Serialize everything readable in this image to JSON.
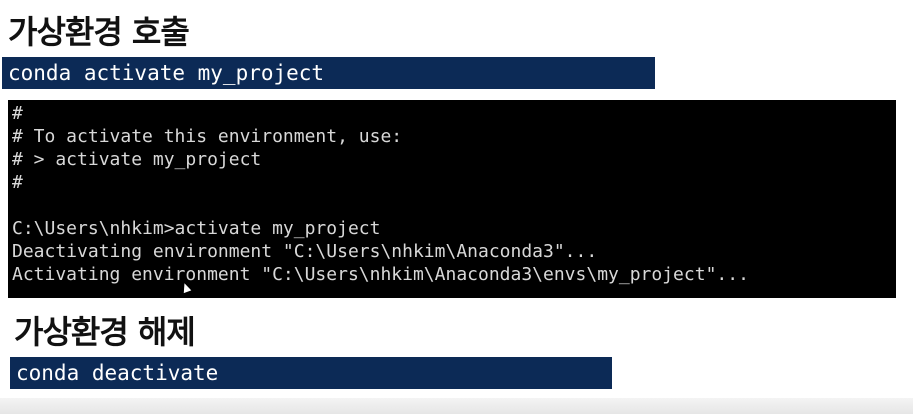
{
  "activate_section": {
    "heading": "가상환경 호출",
    "command": "conda activate my_project"
  },
  "terminal": {
    "lines": [
      "#",
      "# To activate this environment, use:",
      "# > activate my_project",
      "#",
      "",
      "C:\\Users\\nhkim>activate my_project",
      "Deactivating environment \"C:\\Users\\nhkim\\Anaconda3\"...",
      "Activating environment \"C:\\Users\\nhkim\\Anaconda3\\envs\\my_project\"..."
    ]
  },
  "deactivate_section": {
    "heading": "가상환경 해제",
    "command": "conda deactivate"
  },
  "colors": {
    "command_bar_background": "#0c2a56",
    "terminal_background": "#000000",
    "terminal_text": "#d8d8d8"
  },
  "icons": {
    "cursor": "mouse-pointer-icon"
  }
}
